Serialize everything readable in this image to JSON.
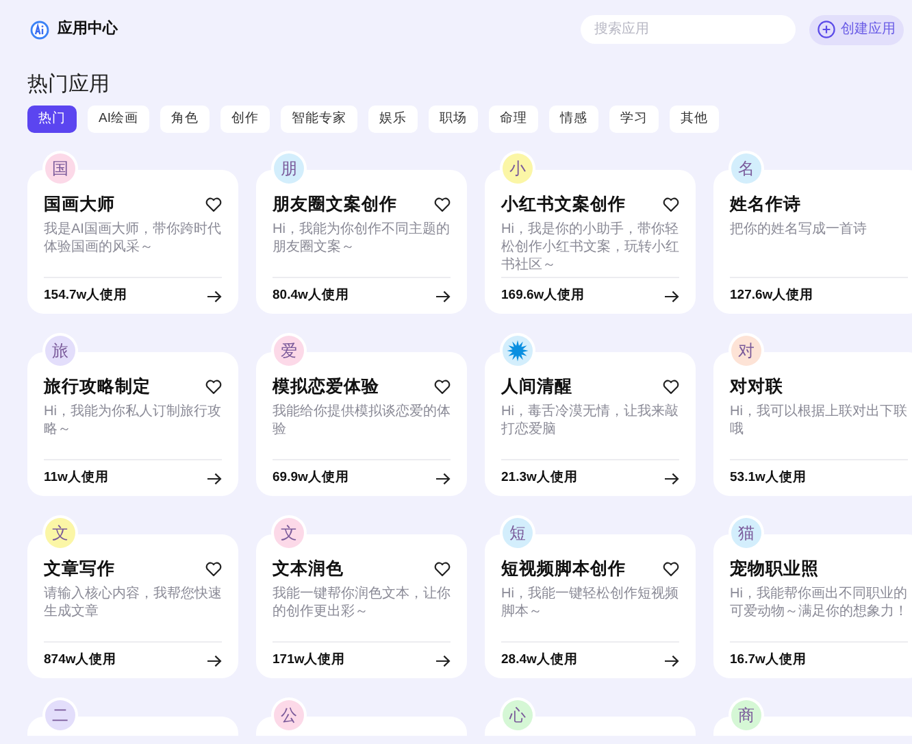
{
  "header": {
    "title": "应用中心",
    "search": {
      "placeholder": "搜索应用"
    },
    "create_button": "创建应用"
  },
  "section_title": "热门应用",
  "tabs": [
    {
      "label": "热门",
      "selected": true
    },
    {
      "label": "AI绘画",
      "selected": false
    },
    {
      "label": "角色",
      "selected": false
    },
    {
      "label": "创作",
      "selected": false
    },
    {
      "label": "智能专家",
      "selected": false
    },
    {
      "label": "娱乐",
      "selected": false
    },
    {
      "label": "职场",
      "selected": false
    },
    {
      "label": "命理",
      "selected": false
    },
    {
      "label": "情感",
      "selected": false
    },
    {
      "label": "学习",
      "selected": false
    },
    {
      "label": "其他",
      "selected": false
    }
  ],
  "cards": [
    {
      "avatar": "国",
      "color": "#fcd9e8",
      "title": "国画大师",
      "description": "我是AI国画大师，带你跨时代体验国画的风采～",
      "usage": "154.7w人使用",
      "has_actions": true
    },
    {
      "avatar": "朋",
      "color": "#d3eefc",
      "title": "朋友圈文案创作",
      "description": "Hi，我能为你创作不同主题的朋友圈文案～",
      "usage": "80.4w人使用",
      "has_actions": true
    },
    {
      "avatar": "小",
      "color": "#fbf6a6",
      "title": "小红书文案创作",
      "description": "Hi，我是你的小助手，带你轻松创作小红书文案，玩转小红书社区～",
      "usage": "169.6w人使用",
      "has_actions": true
    },
    {
      "avatar": "名",
      "color": "#d3eefc",
      "title": "姓名作诗",
      "description": "把你的姓名写成一首诗",
      "usage": "127.6w人使用",
      "has_actions": false
    },
    {
      "avatar": "旅",
      "color": "#e3defb",
      "title": "旅行攻略制定",
      "description": "Hi，我能为你私人订制旅行攻略～",
      "usage": "11w人使用",
      "has_actions": true
    },
    {
      "avatar": "爱",
      "color": "#fcd9e8",
      "title": "模拟恋爱体验",
      "description": "我能给你提供模拟谈恋爱的体验",
      "usage": "69.9w人使用",
      "has_actions": true
    },
    {
      "kind": "burst",
      "color": "#d3eefc",
      "title": "人间清醒",
      "description": "Hi，毒舌冷漠无情，让我来敲打恋爱脑",
      "usage": "21.3w人使用",
      "has_actions": true
    },
    {
      "avatar": "对",
      "color": "#fde3d6",
      "title": "对对联",
      "description": "Hi，我可以根据上联对出下联哦",
      "usage": "53.1w人使用",
      "has_actions": false
    },
    {
      "avatar": "文",
      "color": "#fbf6a6",
      "title": "文章写作",
      "description": "请输入核心内容，我帮您快速生成文章",
      "usage": "874w人使用",
      "has_actions": true
    },
    {
      "avatar": "文",
      "color": "#fcd9e8",
      "title": "文本润色",
      "description": "我能一键帮你润色文本，让你的创作更出彩～",
      "usage": "171w人使用",
      "has_actions": true
    },
    {
      "avatar": "短",
      "color": "#d3eefc",
      "title": "短视频脚本创作",
      "description": "Hi，我能一键轻松创作短视频脚本～",
      "usage": "28.4w人使用",
      "has_actions": true
    },
    {
      "avatar": "猫",
      "color": "#d3eefc",
      "title": "宠物职业照",
      "description": "Hi，我能帮你画出不同职业的可爱动物～满足你的想象力！",
      "usage": "16.7w人使用",
      "has_actions": false
    },
    {
      "avatar": "二",
      "color": "#e3defb"
    },
    {
      "avatar": "公",
      "color": "#fcd9e8"
    },
    {
      "avatar": "心",
      "color": "#d5f7d5"
    },
    {
      "avatar": "商",
      "color": "#d5f7d5"
    }
  ]
}
